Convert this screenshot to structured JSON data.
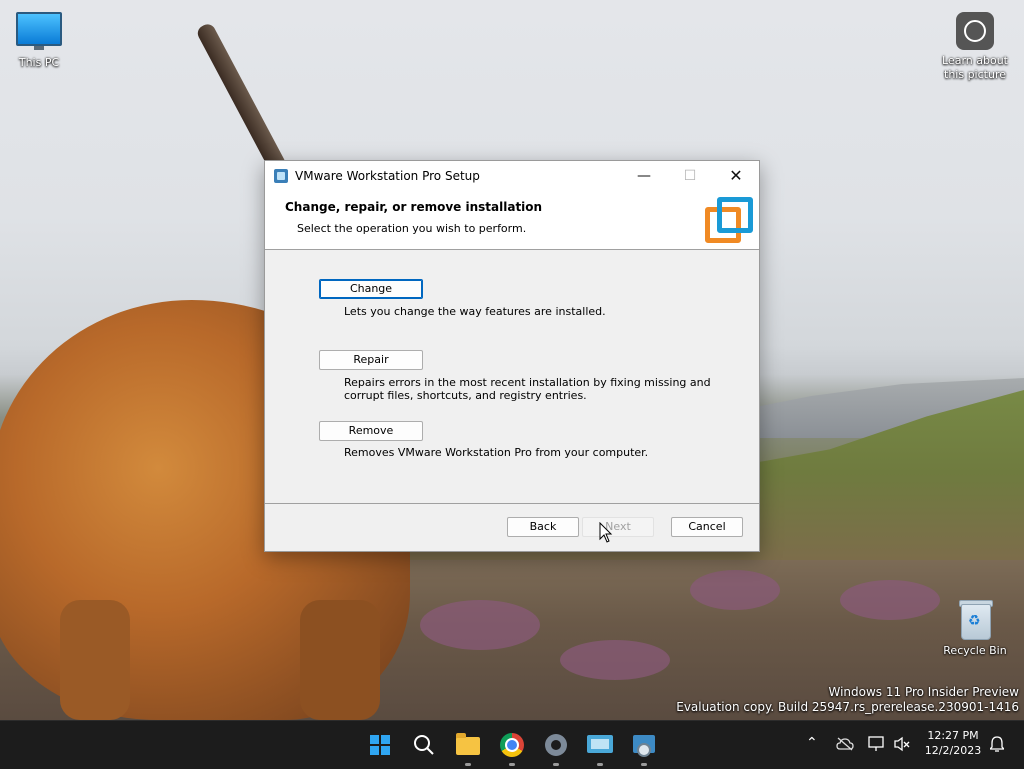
{
  "desktop": {
    "icons": [
      {
        "label": "This PC"
      },
      {
        "label": "Learn about\nthis picture"
      },
      {
        "label": "Recycle Bin"
      }
    ],
    "watermark": {
      "line1": "Windows 11 Pro Insider Preview",
      "line2": "Evaluation copy. Build 25947.rs_prerelease.230901-1416"
    }
  },
  "dialog": {
    "title": "VMware Workstation Pro Setup",
    "header_title": "Change, repair, or remove installation",
    "header_subtitle": "Select the operation you wish to perform.",
    "options": [
      {
        "button": "Change",
        "description": "Lets you change the way features are installed."
      },
      {
        "button": "Repair",
        "description": "Repairs errors in the most recent installation by fixing missing and corrupt files, shortcuts, and registry entries."
      },
      {
        "button": "Remove",
        "description": "Removes VMware Workstation Pro from your computer."
      }
    ],
    "footer": {
      "back": "Back",
      "next": "Next",
      "cancel": "Cancel"
    },
    "window_controls": {
      "minimize": "—",
      "maximize": "☐",
      "close": "✕"
    }
  },
  "taskbar": {
    "apps": [
      "start",
      "search",
      "file-explorer",
      "chrome",
      "settings",
      "remote-desktop",
      "vmware-setup"
    ],
    "clock": {
      "time": "12:27 PM",
      "date": "12/2/2023"
    }
  }
}
